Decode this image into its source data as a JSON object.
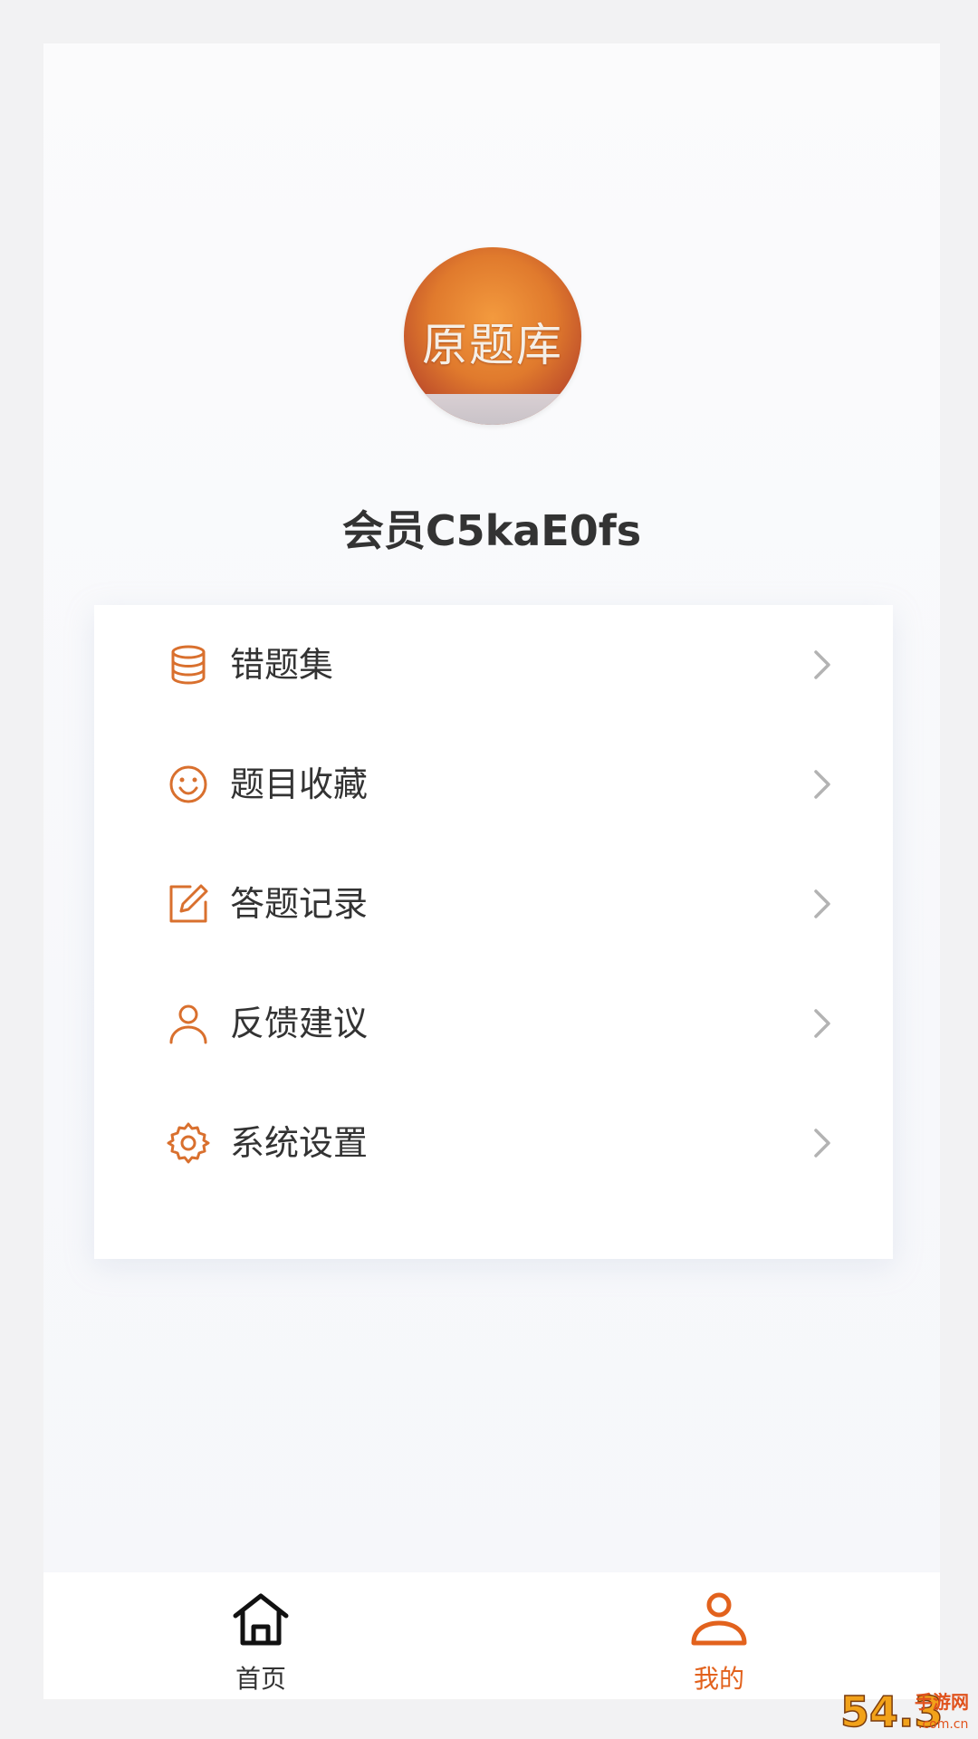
{
  "profile": {
    "avatar_text": "原题库",
    "username": "会员C5kaE0fs"
  },
  "menu": {
    "items": [
      {
        "label": "错题集",
        "icon": "database-icon"
      },
      {
        "label": "题目收藏",
        "icon": "smiley-icon"
      },
      {
        "label": "答题记录",
        "icon": "edit-icon"
      },
      {
        "label": "反馈建议",
        "icon": "user-icon"
      },
      {
        "label": "系统设置",
        "icon": "gear-icon"
      }
    ]
  },
  "tabbar": {
    "tabs": [
      {
        "label": "首页",
        "icon": "home-icon",
        "active": false
      },
      {
        "label": "我的",
        "icon": "user-icon",
        "active": true
      }
    ]
  },
  "colors": {
    "accent": "#e2621d",
    "icon_orange": "#d9702e",
    "text": "#333333",
    "chevron": "#b3b3b3"
  },
  "watermark": {
    "brand": "54.3",
    "site": "手游网",
    "domain": ".com.cn"
  }
}
